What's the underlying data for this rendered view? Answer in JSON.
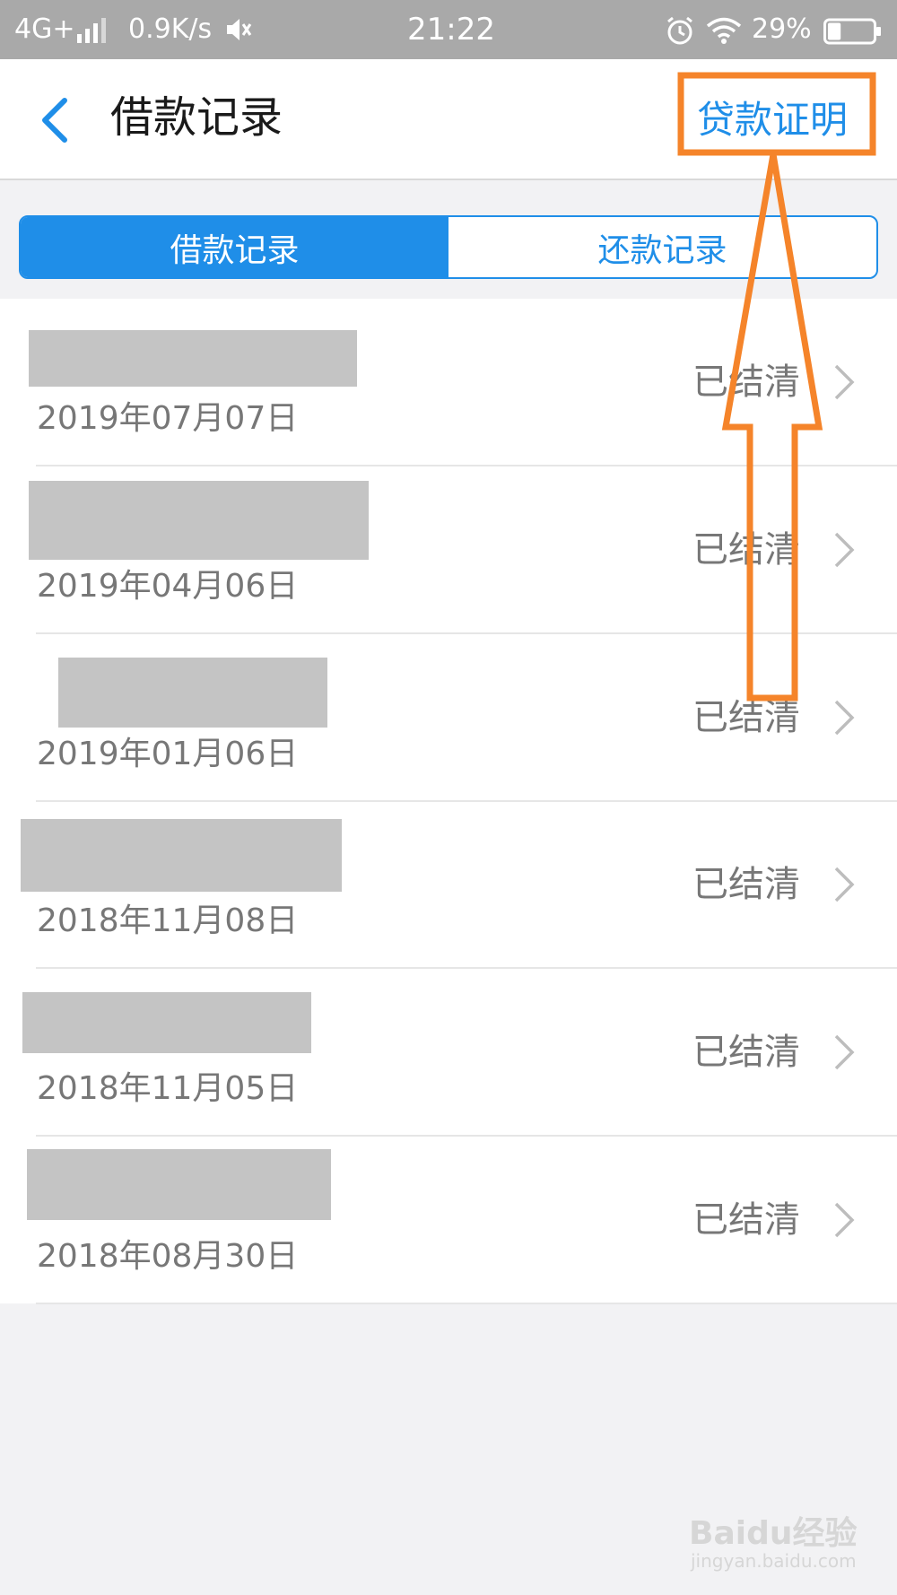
{
  "status_bar": {
    "network": "4G+",
    "speed": "0.9K/s",
    "time": "21:22",
    "battery_percent": "29%",
    "battery_level": 0.29
  },
  "nav": {
    "title": "借款记录",
    "action_label": "贷款证明"
  },
  "tabs": [
    {
      "label": "借款记录",
      "active": true
    },
    {
      "label": "还款记录",
      "active": false
    }
  ],
  "records": [
    {
      "date": "2019年07月07日",
      "status": "已结清"
    },
    {
      "date": "2019年04月06日",
      "status": "已结清"
    },
    {
      "date": "2019年01月06日",
      "status": "已结清"
    },
    {
      "date": "2018年11月08日",
      "status": "已结清"
    },
    {
      "date": "2018年11月05日",
      "status": "已结清"
    },
    {
      "date": "2018年08月30日",
      "status": "已结清"
    }
  ],
  "watermark": {
    "logo": "Baidu经验",
    "url": "jingyan.baidu.com"
  },
  "colors": {
    "accent": "#1f8ee8",
    "annotation": "#f5842a",
    "redaction": "#c4c4c4"
  }
}
